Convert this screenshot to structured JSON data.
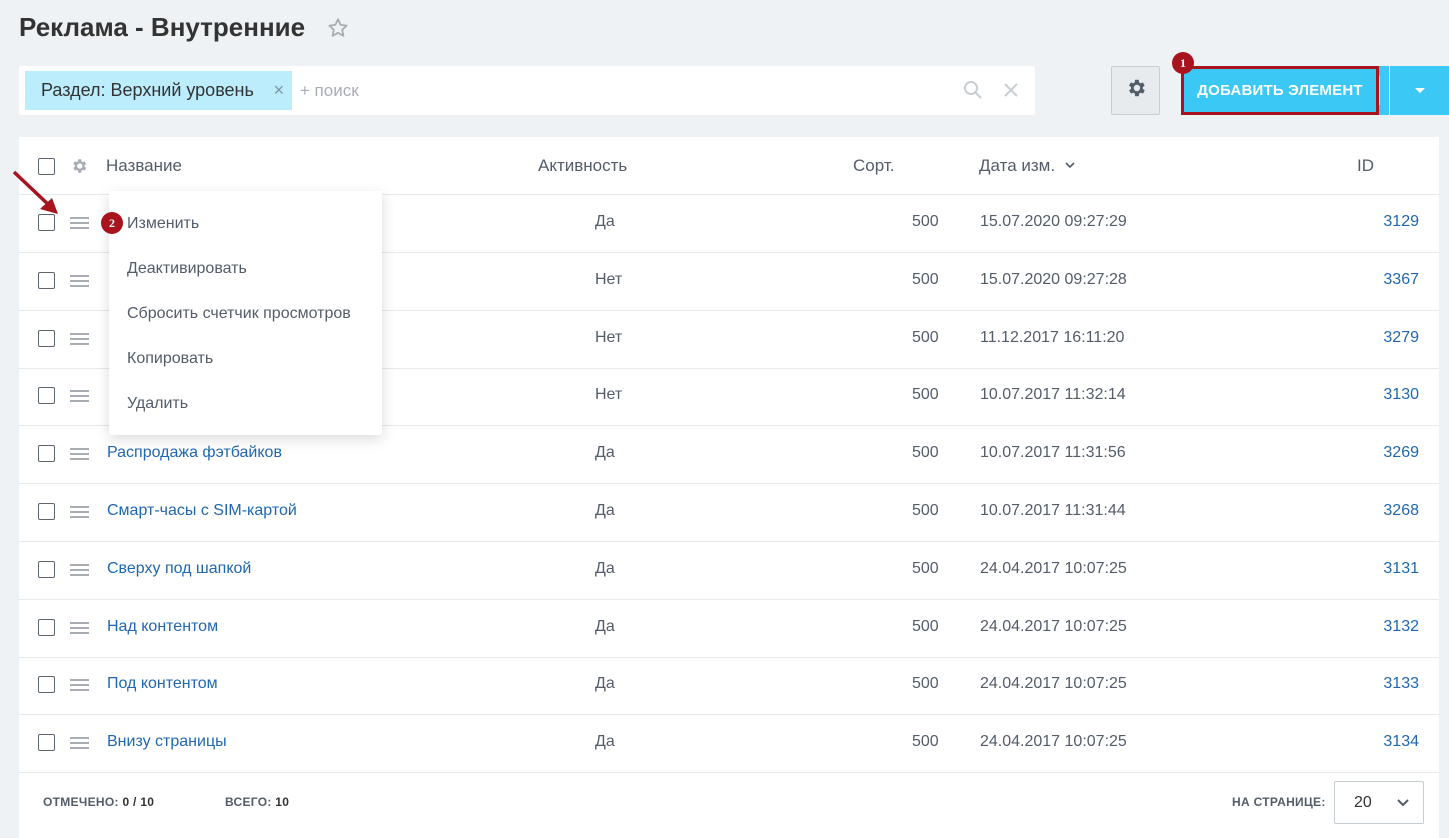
{
  "page": {
    "title": "Реклама - Внутренние"
  },
  "filter": {
    "chip_label": "Раздел: Верхний уровень",
    "chip_close": "×",
    "search_placeholder": "+ поиск"
  },
  "toolbar": {
    "add_label": "ДОБАВИТЬ ЭЛЕМЕНТ",
    "badge_add": "1"
  },
  "columns": {
    "name": "Название",
    "active": "Активность",
    "sort": "Сорт.",
    "date": "Дата изм.",
    "id": "ID"
  },
  "context_menu": {
    "badge": "2",
    "items": [
      "Изменить",
      "Деактивировать",
      "Сбросить счетчик просмотров",
      "Копировать",
      "Удалить"
    ]
  },
  "rows": [
    {
      "name": "",
      "active": "Да",
      "sort": "500",
      "date": "15.07.2020 09:27:29",
      "id": "3129"
    },
    {
      "name": "",
      "active": "Нет",
      "sort": "500",
      "date": "15.07.2020 09:27:28",
      "id": "3367"
    },
    {
      "name": "",
      "active": "Нет",
      "sort": "500",
      "date": "11.12.2017 16:11:20",
      "id": "3279"
    },
    {
      "name": "",
      "active": "Нет",
      "sort": "500",
      "date": "10.07.2017 11:32:14",
      "id": "3130"
    },
    {
      "name": "Распродажа фэтбайков",
      "active": "Да",
      "sort": "500",
      "date": "10.07.2017 11:31:56",
      "id": "3269"
    },
    {
      "name": "Смарт-часы с SIM-картой",
      "active": "Да",
      "sort": "500",
      "date": "10.07.2017 11:31:44",
      "id": "3268"
    },
    {
      "name": "Сверху под шапкой",
      "active": "Да",
      "sort": "500",
      "date": "24.04.2017 10:07:25",
      "id": "3131"
    },
    {
      "name": "Над контентом",
      "active": "Да",
      "sort": "500",
      "date": "24.04.2017 10:07:25",
      "id": "3132"
    },
    {
      "name": "Под контентом",
      "active": "Да",
      "sort": "500",
      "date": "24.04.2017 10:07:25",
      "id": "3133"
    },
    {
      "name": "Внизу страницы",
      "active": "Да",
      "sort": "500",
      "date": "24.04.2017 10:07:25",
      "id": "3134"
    }
  ],
  "footer": {
    "checked_label": "ОТМЕЧЕНО:",
    "checked_value": "0 / 10",
    "total_label": "ВСЕГО:",
    "total_value": "10",
    "per_page_label": "НА СТРАНИЦЕ:",
    "per_page_value": "20"
  },
  "colors": {
    "accent": "#3bc8f5",
    "link": "#2067b0",
    "highlight": "#a8141e",
    "chip": "#bcedfc"
  }
}
